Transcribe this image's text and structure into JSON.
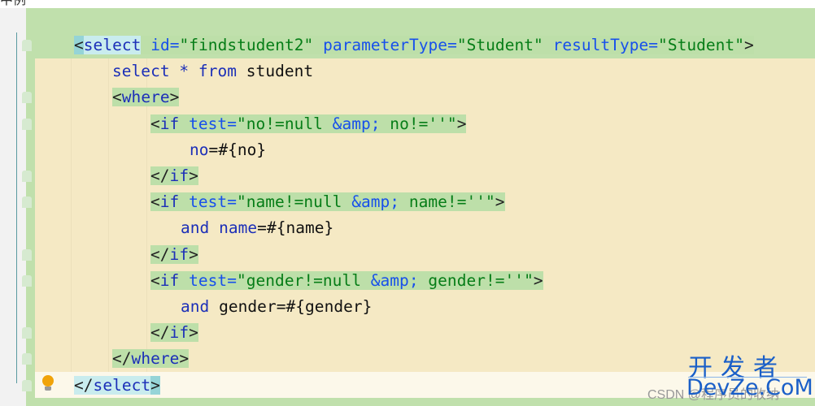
{
  "top_text": "中例",
  "colors": {
    "tag_highlight": "#bddfa9",
    "block_bg": "#f5e9c4",
    "tag": "#1c2fb8",
    "attr": "#1750eb",
    "string": "#067d17"
  },
  "gutter": {
    "intention_icon": "lightbulb-icon",
    "fold_icon": "fold-marker-icon"
  },
  "code_lines": [
    [
      {
        "t": "<",
        "c": "bracket",
        "h": "match2"
      },
      {
        "t": "select",
        "c": "tag",
        "h": "match"
      },
      {
        "t": " ",
        "c": "text",
        "h": "hl"
      },
      {
        "t": "id=",
        "c": "attr",
        "h": "hl"
      },
      {
        "t": "\"findstudent2\"",
        "c": "str",
        "h": "hl"
      },
      {
        "t": " ",
        "c": "text",
        "h": "hl"
      },
      {
        "t": "parameterType=",
        "c": "attr",
        "h": "hl"
      },
      {
        "t": "\"Student\"",
        "c": "str",
        "h": "hl"
      },
      {
        "t": " ",
        "c": "text",
        "h": "hl"
      },
      {
        "t": "resultType=",
        "c": "attr",
        "h": "hl"
      },
      {
        "t": "\"Student\"",
        "c": "str",
        "h": "hl"
      },
      {
        "t": ">",
        "c": "bracket",
        "h": "hl"
      }
    ],
    [
      {
        "t": "select * from ",
        "c": "kw"
      },
      {
        "t": "student",
        "c": "text"
      }
    ],
    [
      {
        "t": "<",
        "c": "bracket",
        "h": "hl"
      },
      {
        "t": "where",
        "c": "tag",
        "h": "hl"
      },
      {
        "t": ">",
        "c": "bracket",
        "h": "hl"
      }
    ],
    [
      {
        "t": "<",
        "c": "bracket",
        "h": "hl"
      },
      {
        "t": "if",
        "c": "tag",
        "h": "hl"
      },
      {
        "t": " ",
        "c": "text",
        "h": "hl"
      },
      {
        "t": "test=",
        "c": "attr",
        "h": "hl"
      },
      {
        "t": "\"no!=null ",
        "c": "str",
        "h": "hl"
      },
      {
        "t": "&amp;",
        "c": "amp",
        "h": "hl"
      },
      {
        "t": " no!=''\"",
        "c": "str",
        "h": "hl"
      },
      {
        "t": ">",
        "c": "bracket",
        "h": "hl"
      }
    ],
    [
      {
        "t": "no",
        "c": "kw"
      },
      {
        "t": "=#{no}",
        "c": "text"
      }
    ],
    [
      {
        "t": "</",
        "c": "bracket",
        "h": "hl"
      },
      {
        "t": "if",
        "c": "tag",
        "h": "hl"
      },
      {
        "t": ">",
        "c": "bracket",
        "h": "hl"
      }
    ],
    [
      {
        "t": "<",
        "c": "bracket",
        "h": "hl"
      },
      {
        "t": "if",
        "c": "tag",
        "h": "hl"
      },
      {
        "t": " ",
        "c": "text",
        "h": "hl"
      },
      {
        "t": "test=",
        "c": "attr",
        "h": "hl"
      },
      {
        "t": "\"name!=null ",
        "c": "str",
        "h": "hl"
      },
      {
        "t": "&amp;",
        "c": "amp",
        "h": "hl"
      },
      {
        "t": " name!=''\"",
        "c": "str",
        "h": "hl"
      },
      {
        "t": ">",
        "c": "bracket",
        "h": "hl"
      }
    ],
    [
      {
        "t": "and name",
        "c": "kw"
      },
      {
        "t": "=#{name}",
        "c": "text"
      }
    ],
    [
      {
        "t": "</",
        "c": "bracket",
        "h": "hl"
      },
      {
        "t": "if",
        "c": "tag",
        "h": "hl"
      },
      {
        "t": ">",
        "c": "bracket",
        "h": "hl"
      }
    ],
    [
      {
        "t": "<",
        "c": "bracket",
        "h": "hl"
      },
      {
        "t": "if",
        "c": "tag",
        "h": "hl"
      },
      {
        "t": " ",
        "c": "text",
        "h": "hl"
      },
      {
        "t": "test=",
        "c": "attr",
        "h": "hl"
      },
      {
        "t": "\"gender!=null ",
        "c": "str",
        "h": "hl"
      },
      {
        "t": "&amp;",
        "c": "amp",
        "h": "hl"
      },
      {
        "t": " gender!=''\"",
        "c": "str",
        "h": "hl"
      },
      {
        "t": ">",
        "c": "bracket",
        "h": "hl"
      }
    ],
    [
      {
        "t": "and ",
        "c": "kw"
      },
      {
        "t": "gender=#{gender}",
        "c": "text"
      }
    ],
    [
      {
        "t": "</",
        "c": "bracket",
        "h": "hl"
      },
      {
        "t": "if",
        "c": "tag",
        "h": "hl"
      },
      {
        "t": ">",
        "c": "bracket",
        "h": "hl"
      }
    ],
    [
      {
        "t": "</",
        "c": "bracket",
        "h": "hl"
      },
      {
        "t": "where",
        "c": "tag",
        "h": "hl"
      },
      {
        "t": ">",
        "c": "bracket",
        "h": "hl"
      }
    ],
    [
      {
        "t": "</",
        "c": "bracket",
        "h": "match"
      },
      {
        "t": "select",
        "c": "tag",
        "h": "match"
      },
      {
        "t": ">",
        "c": "bracket",
        "h": "match2"
      }
    ]
  ],
  "watermark": {
    "logo_cn": "开发者",
    "logo_en": "DevZe.CoM",
    "csdn": "CSDN @程序员的收纳"
  }
}
